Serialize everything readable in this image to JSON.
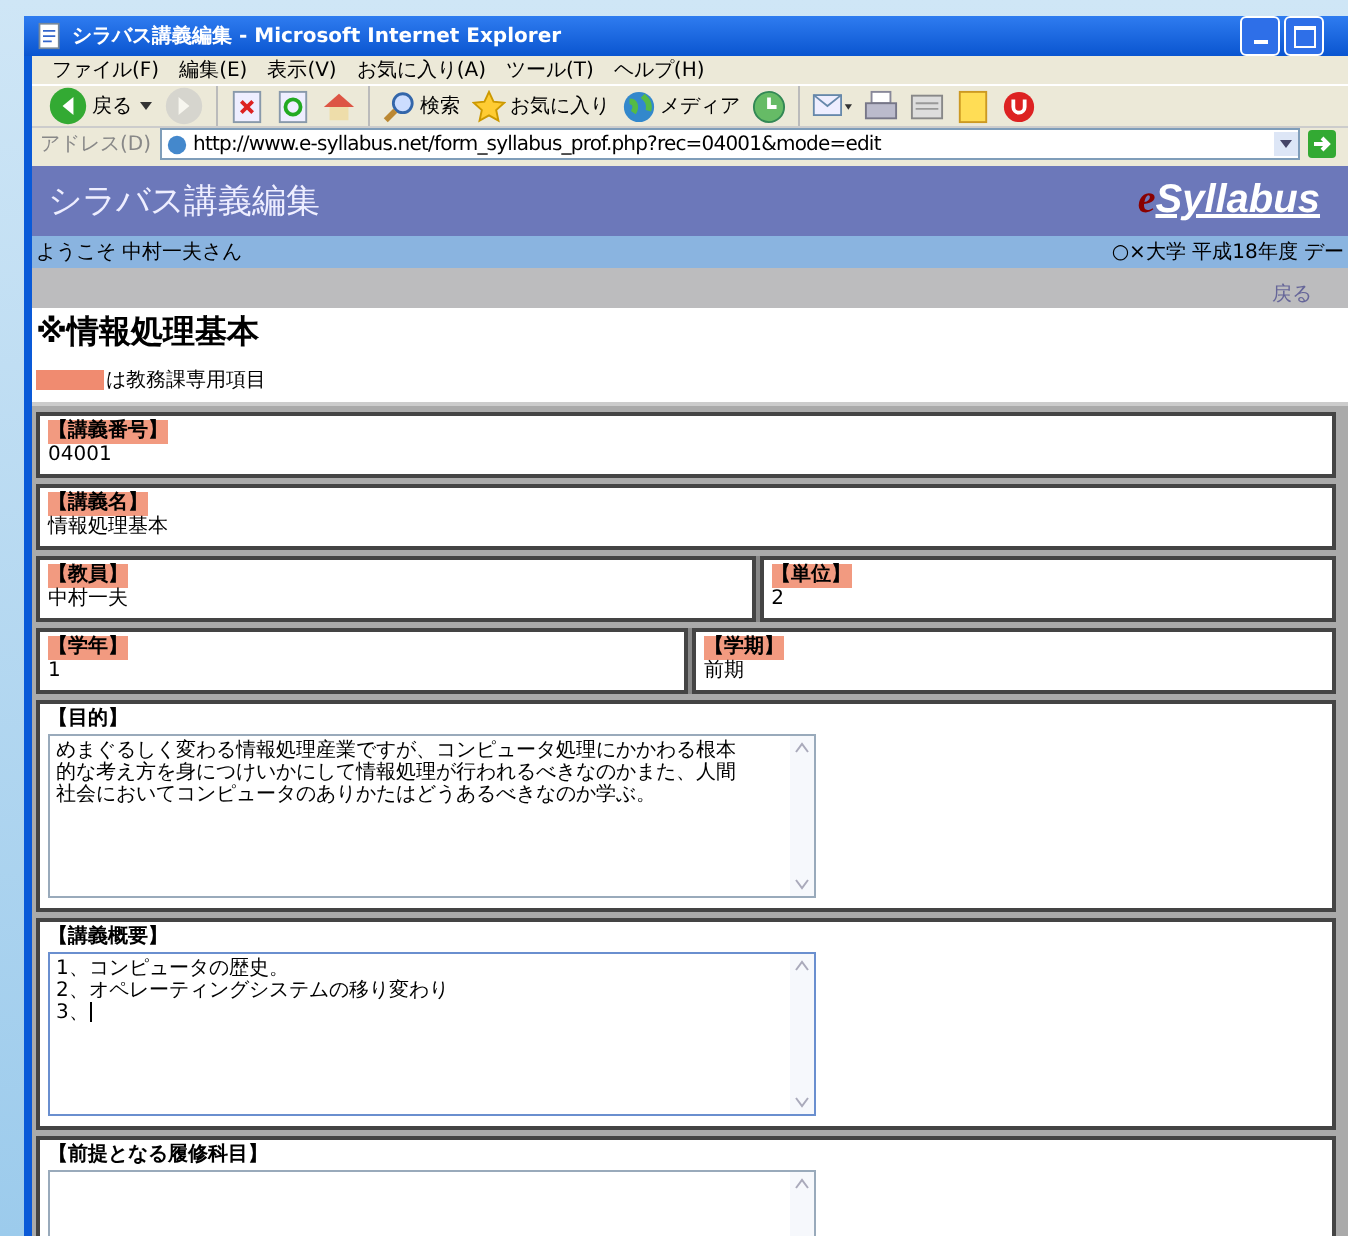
{
  "window": {
    "title": "シラバス講義編集 - Microsoft Internet Explorer"
  },
  "menu": [
    "ファイル(F)",
    "編集(E)",
    "表示(V)",
    "お気に入り(A)",
    "ツール(T)",
    "ヘルプ(H)"
  ],
  "toolbar": [
    {
      "kind": "back",
      "label": "戻る",
      "disabled": false
    },
    {
      "kind": "forward",
      "disabled": true
    },
    {
      "kind": "stop",
      "disabled": false
    },
    {
      "kind": "refresh",
      "disabled": false
    },
    {
      "kind": "home",
      "disabled": false
    },
    {
      "kind": "search",
      "label": "検索",
      "disabled": false
    },
    {
      "kind": "favorites",
      "label": "お気に入り",
      "disabled": false
    },
    {
      "kind": "media",
      "label": "メディア",
      "disabled": false
    },
    {
      "kind": "history",
      "disabled": false
    },
    {
      "kind": "mail",
      "disabled": false
    },
    {
      "kind": "print",
      "disabled": false
    },
    {
      "kind": "edit",
      "disabled": false
    },
    {
      "kind": "note",
      "disabled": false
    },
    {
      "kind": "power",
      "disabled": false
    }
  ],
  "address": {
    "label": "アドレス(D)",
    "url": "http://www.e-syllabus.net/form_syllabus_prof.php?rec=04001&mode=edit"
  },
  "page": {
    "heading": "シラバス講義編集",
    "logo_prefix": "e",
    "logo_name": "Syllabus",
    "welcome": "ようこそ 中村一夫さん",
    "university": "○×大学 平成18年度 デー",
    "back_link": "戻る",
    "title": "※情報処理基本",
    "legend": "は教務課専用項目"
  },
  "rows": [
    [
      {
        "kind": "text",
        "label": "【講義番号】",
        "restricted": true,
        "value": "04001"
      }
    ],
    [
      {
        "kind": "text",
        "label": "【講義名】",
        "restricted": true,
        "value": "情報処理基本"
      }
    ],
    [
      {
        "kind": "text",
        "label": "【教員】",
        "restricted": true,
        "value": "中村一夫"
      },
      {
        "kind": "text",
        "label": "【単位】",
        "restricted": true,
        "value": "2"
      }
    ],
    [
      {
        "kind": "text",
        "label": "【学年】",
        "restricted": true,
        "value": "1"
      },
      {
        "kind": "text",
        "label": "【学期】",
        "restricted": true,
        "value": "前期"
      }
    ],
    [
      {
        "kind": "textarea",
        "label": "【目的】",
        "restricted": false,
        "lines": [
          "めまぐるしく変わる情報処理産業ですが、コンピュータ処理にかかわる根本",
          "的な考え方を身につけいかにして情報処理が行われるべきなのかまた、人間",
          "社会においてコンピュータのありかたはどうあるべきなのか学ぶ。"
        ],
        "focused": false
      }
    ],
    [
      {
        "kind": "textarea",
        "label": "【講義概要】",
        "restricted": false,
        "lines": [
          "1、コンピュータの歴史。",
          "2、オペレーティングシステムの移り変わり",
          "3、"
        ],
        "focused": true
      }
    ],
    [
      {
        "kind": "textarea",
        "label": "【前提となる履修科目】",
        "restricted": false,
        "focused": false
      }
    ]
  ]
}
